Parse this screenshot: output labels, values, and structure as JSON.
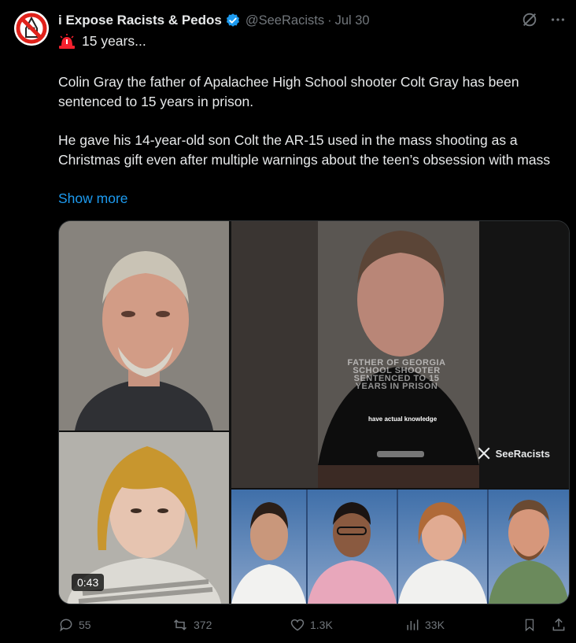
{
  "tweet": {
    "display_name": "i Expose Racists & Pedos",
    "handle": "@SeeRacists",
    "separator": "·",
    "date": "Jul 30",
    "subline": "15 years...",
    "paragraph_1": "Colin Gray the father of Apalachee High School shooter Colt Gray has been sentenced to 15 years in prison.",
    "paragraph_2": "He gave his 14-year-old son Colt the AR-15 used in the mass shooting as a Christmas gift even after multiple warnings about the teen’s obsession with mass",
    "show_more": "Show more"
  },
  "media": {
    "overlay_line_1": "FATHER OF GEORGIA",
    "overlay_line_2": "SCHOOL SHOOTER",
    "overlay_line_3": "SENTENCED TO 15",
    "overlay_line_4": "YEARS IN PRISON",
    "caption": "have actual knowledge",
    "watermark": "SeeRacists",
    "duration": "0:43"
  },
  "actions": {
    "replies": "55",
    "reposts": "372",
    "likes": "1.3K",
    "views": "33K"
  },
  "colors": {
    "background": "#000000",
    "text": "#e7e9ea",
    "muted": "#71767b",
    "link": "#1d9bf0",
    "verified": "#1d9bf0",
    "siren": "#f4212e"
  }
}
